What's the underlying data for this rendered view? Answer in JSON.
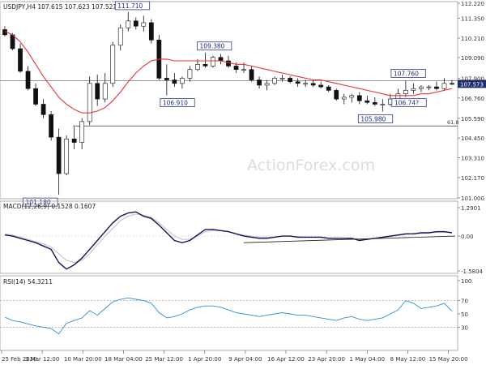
{
  "chart_data": [
    {
      "type": "line",
      "subtype": "candlestick",
      "title": "USDJPY,H4  107.615 107.623 107.521 107.573",
      "symbol": "USDJPY",
      "timeframe": "H4",
      "ohlc_header": {
        "open": 107.615,
        "high": 107.623,
        "low": 107.521,
        "close": 107.573
      },
      "last_price": 107.573,
      "ylim": [
        101.0,
        112.22
      ],
      "y_ticks": [
        "112.220",
        "111.350",
        "110.210",
        "109.090",
        "107.900",
        "106.760",
        "105.590",
        "104.450",
        "103.310",
        "102.170",
        "101.000"
      ],
      "x_ticks": [
        "25 Feb 2020",
        "3 Mar 12:00",
        "10 Mar 20:00",
        "18 Mar 04:00",
        "25 Mar 12:00",
        "1 Apr 20:00",
        "9 Apr 04:00",
        "16 Apr 12:00",
        "23 Apr 20:00",
        "1 May 04:00",
        "8 May 12:00",
        "15 May 20:00"
      ],
      "series": [
        {
          "type": "candlestick",
          "x": [
            "25 Feb",
            "27 Feb",
            "28 Feb",
            "2 Mar",
            "4 Mar",
            "5 Mar",
            "6 Mar",
            "9 Mar",
            "10 Mar",
            "11 Mar",
            "12 Mar",
            "13 Mar",
            "16 Mar",
            "17 Mar",
            "18 Mar",
            "19 Mar",
            "20 Mar",
            "23 Mar",
            "24 Mar",
            "25 Mar",
            "26 Mar",
            "27 Mar",
            "30 Mar",
            "31 Mar",
            "1 Apr",
            "2 Apr",
            "3 Apr",
            "6 Apr",
            "7 Apr",
            "8 Apr",
            "9 Apr",
            "10 Apr",
            "13 Apr",
            "14 Apr",
            "15 Apr",
            "16 Apr",
            "17 Apr",
            "20 Apr",
            "21 Apr",
            "22 Apr",
            "23 Apr",
            "24 Apr",
            "27 Apr",
            "28 Apr",
            "29 Apr",
            "30 Apr",
            "1 May",
            "4 May",
            "5 May",
            "6 May",
            "7 May",
            "8 May",
            "11 May",
            "12 Mar",
            "13 May",
            "14 May",
            "15 May",
            "18 May",
            "19 May"
          ],
          "open": [
            110.7,
            110.4,
            109.6,
            108.3,
            107.3,
            106.4,
            105.8,
            104.5,
            102.4,
            104.4,
            104.2,
            105.4,
            107.6,
            106.7,
            107.6,
            109.8,
            110.8,
            111.2,
            110.9,
            111.1,
            110.1,
            107.9,
            107.8,
            107.6,
            107.9,
            108.4,
            108.7,
            108.6,
            109.1,
            108.9,
            108.6,
            108.4,
            108.4,
            107.8,
            107.5,
            107.6,
            107.9,
            107.9,
            107.7,
            107.6,
            107.6,
            107.5,
            107.4,
            107.2,
            106.7,
            106.8,
            106.9,
            106.6,
            106.5,
            106.4,
            106.4,
            106.7,
            107.0,
            107.2,
            107.3,
            107.4,
            107.4,
            107.3,
            107.6
          ],
          "high": [
            110.9,
            110.5,
            109.9,
            108.6,
            107.6,
            106.7,
            106.0,
            105.0,
            104.6,
            105.1,
            105.6,
            108.0,
            108.1,
            108.2,
            110.0,
            111.0,
            111.71,
            111.4,
            111.5,
            111.3,
            110.4,
            108.7,
            108.2,
            108.0,
            108.6,
            109.0,
            109.38,
            109.2,
            109.3,
            109.2,
            108.8,
            108.8,
            108.6,
            108.0,
            107.8,
            108.0,
            108.1,
            108.0,
            107.9,
            107.8,
            107.8,
            107.7,
            107.5,
            107.3,
            107.0,
            107.0,
            107.1,
            106.9,
            106.8,
            106.7,
            107.0,
            107.3,
            107.76,
            107.6,
            107.5,
            107.5,
            107.7,
            107.9,
            107.8
          ],
          "low": [
            110.3,
            109.5,
            108.2,
            107.2,
            106.3,
            105.6,
            104.3,
            101.18,
            102.3,
            103.8,
            103.8,
            105.2,
            106.3,
            106.5,
            107.4,
            109.5,
            110.6,
            110.7,
            110.6,
            109.9,
            107.8,
            106.91,
            107.4,
            107.3,
            107.7,
            108.3,
            108.5,
            108.5,
            108.7,
            108.5,
            108.2,
            108.2,
            107.7,
            107.3,
            107.2,
            107.5,
            107.7,
            107.6,
            107.4,
            107.4,
            107.4,
            107.3,
            107.1,
            106.6,
            106.4,
            106.5,
            106.4,
            106.4,
            106.3,
            105.98,
            106.3,
            106.6,
            106.8,
            107.0,
            107.1,
            107.2,
            107.2,
            107.2,
            107.5
          ],
          "close": [
            110.4,
            109.6,
            108.3,
            107.3,
            106.4,
            105.8,
            104.5,
            102.4,
            104.4,
            104.2,
            105.4,
            107.6,
            106.7,
            107.6,
            109.8,
            110.8,
            111.2,
            110.9,
            111.1,
            110.1,
            107.9,
            107.8,
            107.6,
            107.9,
            108.4,
            108.7,
            108.6,
            109.1,
            108.9,
            108.6,
            108.4,
            108.4,
            107.8,
            107.5,
            107.6,
            107.9,
            107.9,
            107.7,
            107.6,
            107.6,
            107.5,
            107.4,
            107.2,
            106.7,
            106.8,
            106.9,
            106.6,
            106.5,
            106.4,
            106.4,
            106.7,
            107.0,
            107.2,
            107.3,
            107.4,
            107.4,
            107.3,
            107.6,
            107.573
          ]
        },
        {
          "type": "line",
          "color": "#e5333a",
          "values": [
            110.6,
            110.4,
            110.0,
            109.4,
            108.7,
            108.0,
            107.4,
            106.8,
            106.4,
            106.1,
            105.9,
            105.9,
            106.0,
            106.2,
            106.6,
            107.1,
            107.7,
            108.2,
            108.6,
            108.9,
            109.0,
            109.0,
            108.9,
            108.9,
            108.9,
            108.9,
            108.9,
            108.9,
            108.9,
            108.8,
            108.7,
            108.7,
            108.6,
            108.5,
            108.4,
            108.3,
            108.2,
            108.1,
            108.0,
            107.9,
            107.8,
            107.8,
            107.7,
            107.6,
            107.5,
            107.4,
            107.3,
            107.2,
            107.1,
            107.0,
            106.9,
            106.9,
            106.9,
            106.9,
            107.0,
            107.0,
            107.1,
            107.2,
            107.3
          ]
        }
      ],
      "annotations": [
        "111.710",
        "109.380",
        "106.910",
        "101.180",
        "107.760",
        "105.980",
        "106.74?"
      ],
      "fib_label": "61.8",
      "fib_level": 105.15,
      "resistance_level": 107.76,
      "watermark": "ActionForex.com",
      "price_badge_color": "#1f2f6b",
      "line_color": "#e5333a"
    },
    {
      "type": "line",
      "title": "MACD(12,26,9) 0.1528 0.1607",
      "ylim": [
        -1.5804,
        1.2901
      ],
      "y_ticks": [
        "1.2901",
        "0.00",
        "-1.5804"
      ],
      "series": [
        {
          "name": "",
          "color": "#12125a",
          "values": [
            0.05,
            0.0,
            -0.1,
            -0.2,
            -0.3,
            -0.45,
            -0.6,
            -1.2,
            -1.5,
            -1.3,
            -1.0,
            -0.6,
            -0.2,
            0.2,
            0.6,
            0.9,
            1.05,
            1.1,
            0.9,
            0.8,
            0.5,
            0.15,
            -0.2,
            -0.3,
            -0.2,
            0.05,
            0.3,
            0.3,
            0.25,
            0.2,
            0.1,
            0.0,
            -0.05,
            -0.1,
            -0.1,
            -0.05,
            0.0,
            0.0,
            -0.05,
            -0.05,
            -0.05,
            -0.05,
            -0.1,
            -0.1,
            -0.1,
            -0.1,
            -0.2,
            -0.15,
            -0.1,
            -0.05,
            0.0,
            0.05,
            0.1,
            0.1,
            0.15,
            0.15,
            0.2,
            0.2,
            0.15
          ]
        },
        {
          "name": "",
          "color": "#bfbfbf",
          "values": [
            0.1,
            0.05,
            -0.05,
            -0.15,
            -0.25,
            -0.35,
            -0.5,
            -0.8,
            -1.1,
            -1.2,
            -1.1,
            -0.8,
            -0.4,
            0.0,
            0.35,
            0.7,
            0.9,
            1.0,
            0.95,
            0.85,
            0.6,
            0.3,
            0.0,
            -0.15,
            -0.15,
            0.0,
            0.2,
            0.25,
            0.25,
            0.2,
            0.1,
            0.05,
            0.0,
            -0.05,
            -0.05,
            -0.05,
            0.0,
            0.0,
            -0.03,
            -0.05,
            -0.05,
            -0.05,
            -0.08,
            -0.1,
            -0.1,
            -0.1,
            -0.15,
            -0.15,
            -0.1,
            -0.07,
            -0.02,
            0.03,
            0.08,
            0.1,
            0.12,
            0.14,
            0.17,
            0.18,
            0.16
          ]
        }
      ],
      "trendline": [
        [
          -0.3,
          0.0
        ]
      ]
    },
    {
      "type": "line",
      "title": "RSI(14) 54.3211",
      "ylim": [
        0,
        100
      ],
      "y_ticks": [
        "100",
        "70",
        "50",
        "30",
        "0"
      ],
      "levels": [
        70,
        30
      ],
      "series": [
        {
          "name": "",
          "color": "#2a8fd8",
          "values": [
            45,
            40,
            38,
            35,
            32,
            30,
            28,
            20,
            36,
            40,
            44,
            55,
            48,
            58,
            68,
            72,
            74,
            72,
            70,
            66,
            52,
            44,
            46,
            50,
            56,
            60,
            62,
            62,
            60,
            56,
            52,
            50,
            48,
            46,
            48,
            50,
            52,
            50,
            48,
            48,
            46,
            44,
            42,
            40,
            44,
            46,
            42,
            40,
            42,
            44,
            50,
            56,
            70,
            66,
            58,
            60,
            62,
            66,
            54
          ]
        }
      ]
    }
  ]
}
